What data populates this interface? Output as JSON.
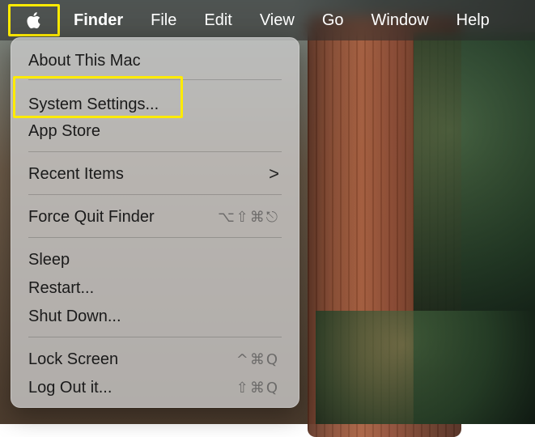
{
  "menubar": {
    "apple_icon": "apple-logo-icon",
    "items": [
      {
        "label": "Finder",
        "bold": true
      },
      {
        "label": "File"
      },
      {
        "label": "Edit"
      },
      {
        "label": "View"
      },
      {
        "label": "Go"
      },
      {
        "label": "Window"
      },
      {
        "label": "Help"
      }
    ]
  },
  "apple_menu": {
    "items": [
      {
        "label": "About This Mac"
      },
      {
        "label": "System Settings..."
      },
      {
        "label": "App Store"
      },
      {
        "label": "Recent Items",
        "submenu_icon": "chevron-right-icon",
        "submenu_glyph": ">"
      },
      {
        "label": "Force Quit Finder",
        "shortcut": "⌥⇧⌘⎋"
      },
      {
        "label": "Sleep"
      },
      {
        "label": "Restart..."
      },
      {
        "label": "Shut Down..."
      },
      {
        "label": "Lock Screen",
        "shortcut": "^⌘Q"
      },
      {
        "label": "Log Out it...",
        "shortcut": "⇧⌘Q"
      }
    ]
  },
  "colors": {
    "highlight": "#ffeb00",
    "menubar_text": "#ffffff",
    "menu_text": "#1a1a1a"
  }
}
